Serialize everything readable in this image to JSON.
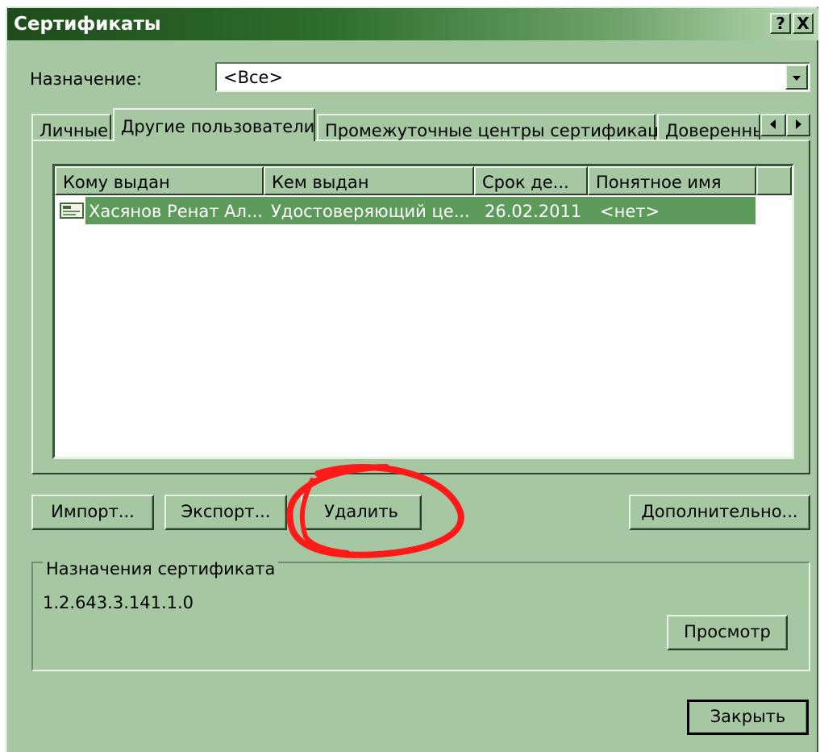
{
  "window": {
    "title": "Сертификаты",
    "help_label": "?",
    "close_label": "X"
  },
  "purpose": {
    "label": "Назначение:",
    "value": "<Все>"
  },
  "tabs": [
    {
      "label": "Личные",
      "selected": false
    },
    {
      "label": "Другие пользователи",
      "selected": true
    },
    {
      "label": "Промежуточные центры сертификации",
      "selected": false
    },
    {
      "label": "Доверенны",
      "selected": false
    }
  ],
  "list": {
    "columns": [
      "Кому выдан",
      "Кем выдан",
      "Срок де...",
      "Понятное имя"
    ],
    "rows": [
      {
        "issued_to": "Хасянов Ренат Ал...",
        "issued_by": "Удостоверяющий це...",
        "expires": "26.02.2011",
        "friendly_name": "<нет>",
        "icon": "certificate-icon",
        "selected": true
      }
    ]
  },
  "buttons": {
    "import": "Импорт...",
    "export": "Экспорт...",
    "delete": "Удалить",
    "advanced": "Дополнительно...",
    "view": "Просмотр",
    "close": "Закрыть"
  },
  "purposes_group": {
    "legend": "Назначения сертификата",
    "value": "1.2.643.3.141.1.0"
  },
  "colors": {
    "window_bg": "#a5c8a3",
    "title_dark": "#1e4c1b",
    "selection": "#5d9a5c",
    "annotation": "#ff1a1a"
  }
}
